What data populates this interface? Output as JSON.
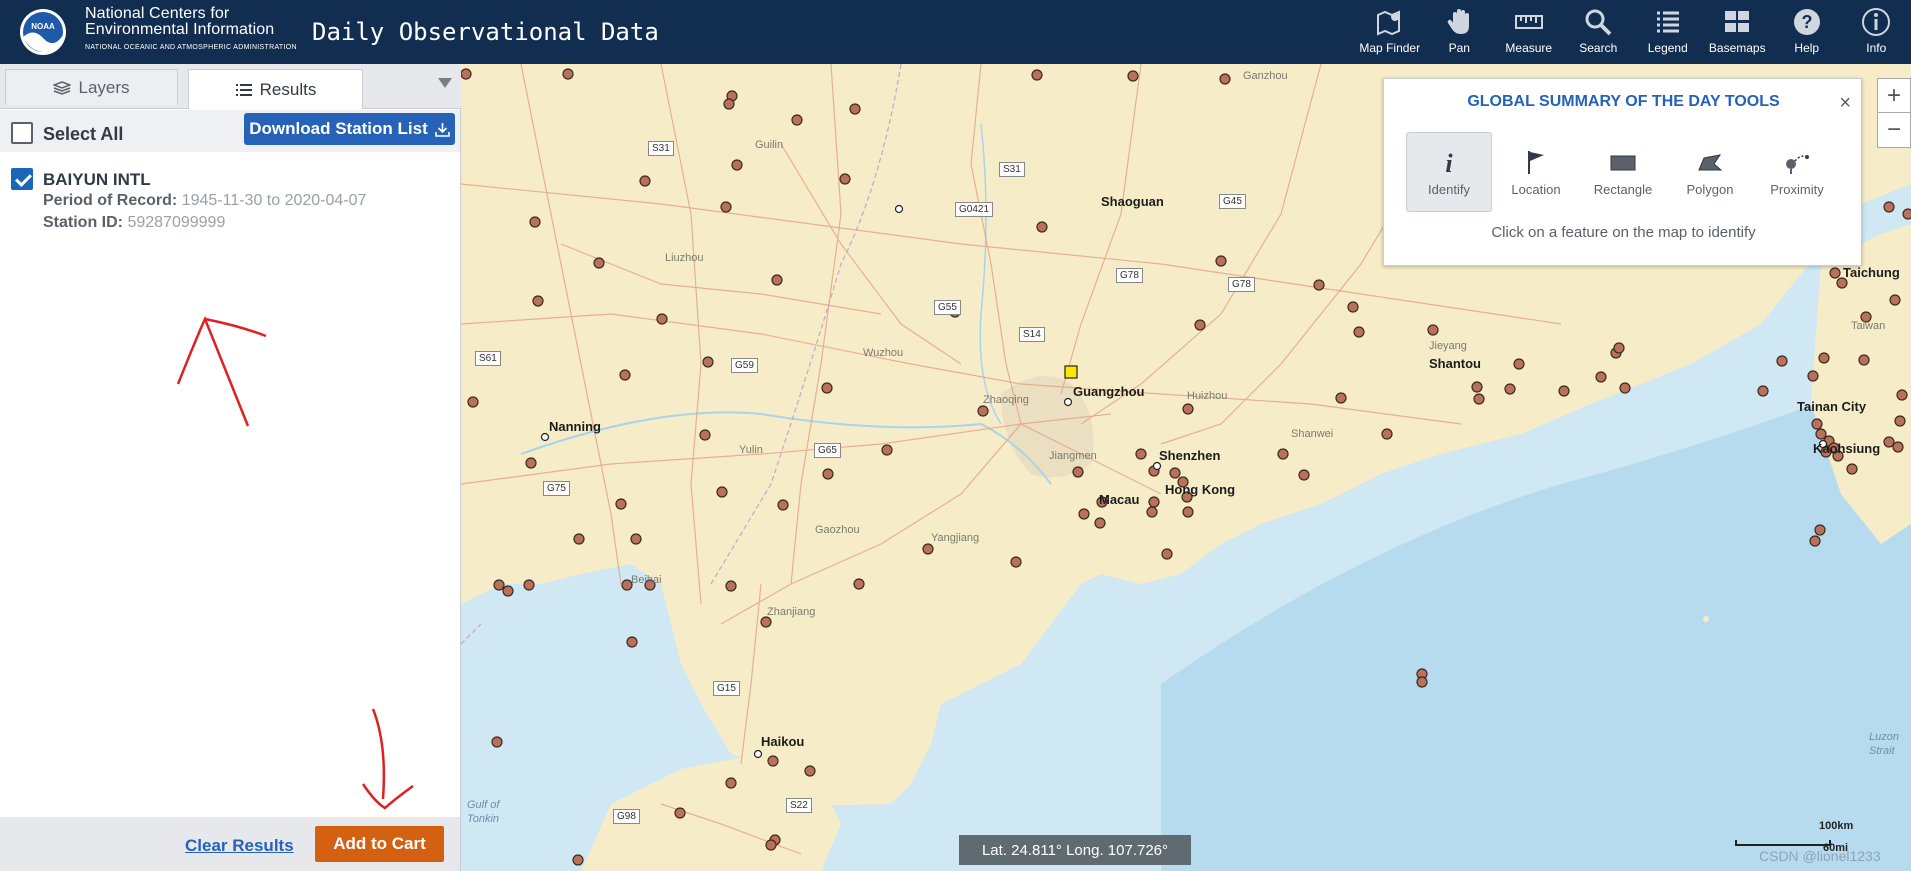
{
  "header": {
    "org_line1": "National Centers for",
    "org_line2": "Environmental Information",
    "org_line3": "NATIONAL OCEANIC AND ATMOSPHERIC ADMINISTRATION",
    "app_title": "Daily Observational Data",
    "tools": [
      {
        "label": "Map Finder",
        "icon": "map-finder-icon"
      },
      {
        "label": "Pan",
        "icon": "pan-hand-icon"
      },
      {
        "label": "Measure",
        "icon": "measure-ruler-icon"
      },
      {
        "label": "Search",
        "icon": "search-icon"
      },
      {
        "label": "Legend",
        "icon": "legend-list-icon"
      },
      {
        "label": "Basemaps",
        "icon": "basemaps-icon"
      },
      {
        "label": "Help",
        "icon": "help-icon"
      },
      {
        "label": "Info",
        "icon": "info-icon"
      }
    ]
  },
  "sidebar": {
    "tabs": [
      {
        "label": "Layers",
        "active": false
      },
      {
        "label": "Results",
        "active": true
      }
    ],
    "select_all_label": "Select All",
    "download_label": "Download Station List",
    "results": [
      {
        "name": "BAIYUN INTL",
        "checked": true,
        "period_label": "Period of Record:",
        "period_value": "1945-11-30 to 2020-04-07",
        "station_label": "Station ID:",
        "station_value": "59287099999"
      }
    ],
    "clear_label": "Clear Results",
    "cart_label": "Add to Cart"
  },
  "tools_panel": {
    "title": "GLOBAL SUMMARY OF THE DAY TOOLS",
    "close": "×",
    "tools": [
      {
        "label": "Identify",
        "active": true
      },
      {
        "label": "Location",
        "active": false
      },
      {
        "label": "Rectangle",
        "active": false
      },
      {
        "label": "Polygon",
        "active": false
      },
      {
        "label": "Proximity",
        "active": false
      }
    ],
    "hint": "Click on a feature on the map to identify"
  },
  "map": {
    "zoom_in": "+",
    "zoom_out": "−",
    "coords": "Lat. 24.811°  Long. 107.726°",
    "scale_km": "100km",
    "scale_mi": "60mi",
    "watermark": "CSDN @lionel1233",
    "places": [
      {
        "name": "Shaoguan",
        "major": true
      },
      {
        "name": "Guangzhou",
        "major": true
      },
      {
        "name": "Shenzhen",
        "major": true
      },
      {
        "name": "Hong Kong",
        "major": true
      },
      {
        "name": "Macau",
        "major": true
      },
      {
        "name": "Shantou",
        "major": true
      },
      {
        "name": "Nanning",
        "major": true
      },
      {
        "name": "Haikou",
        "major": true
      },
      {
        "name": "Tainan City",
        "major": true
      },
      {
        "name": "Kaohsiung",
        "major": true
      },
      {
        "name": "Taichung",
        "major": true
      },
      {
        "name": "Guilin",
        "major": false
      },
      {
        "name": "Liuzhou",
        "major": false
      },
      {
        "name": "Wuzhou",
        "major": false
      },
      {
        "name": "Yulin",
        "major": false
      },
      {
        "name": "Zhaoqing",
        "major": false
      },
      {
        "name": "Jiangmen",
        "major": false
      },
      {
        "name": "Huizhou",
        "major": false
      },
      {
        "name": "Shanwei",
        "major": false
      },
      {
        "name": "Jieyang",
        "major": false
      },
      {
        "name": "Gaozhou",
        "major": false
      },
      {
        "name": "Yangjiang",
        "major": false
      },
      {
        "name": "Zhanjiang",
        "major": false
      },
      {
        "name": "Beihai",
        "major": false
      },
      {
        "name": "Ganzhou",
        "major": false
      },
      {
        "name": "Taiwan",
        "major": false
      }
    ],
    "water": [
      "Gulf of Tonkin",
      "Luzon Strait"
    ],
    "roads": [
      "S31",
      "S31",
      "G0421",
      "G45",
      "G78",
      "G78",
      "G55",
      "S14",
      "S61",
      "G59",
      "G65",
      "G75",
      "G15",
      "S22",
      "G98"
    ]
  }
}
